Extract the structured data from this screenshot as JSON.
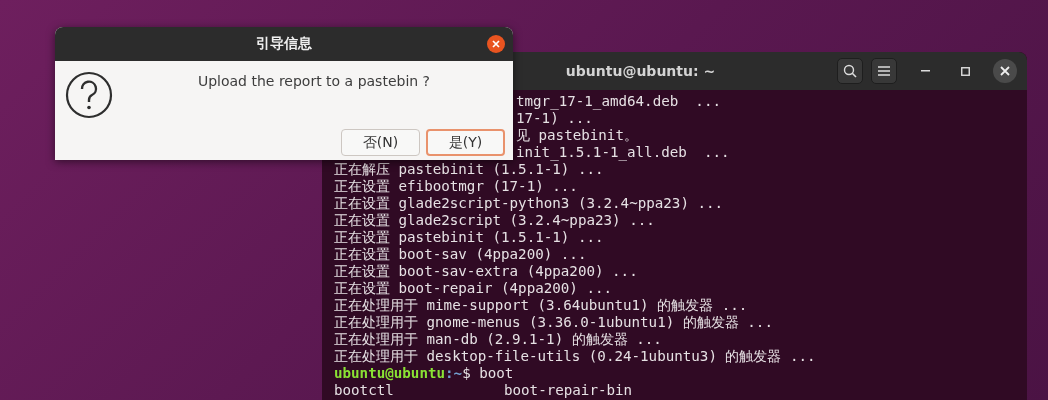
{
  "dialog": {
    "title": "引导信息",
    "message": "Upload the report to a pastebin ?",
    "buttons": [
      {
        "label": "否(N)",
        "selected": false
      },
      {
        "label": "是(Y)",
        "selected": true
      }
    ]
  },
  "terminal": {
    "title": "ubuntu@ubuntu: ~",
    "lines": [
      {
        "kind": "partial",
        "text": "tmgr_17-1_amd64.deb  ..."
      },
      {
        "kind": "partial",
        "text": "17-1) ..."
      },
      {
        "kind": "partial",
        "text": "见 pastebinit。"
      },
      {
        "kind": "partial",
        "text": "init_1.5.1-1_all.deb  ..."
      },
      {
        "kind": "output",
        "text": "正在解压 pastebinit (1.5.1-1) ..."
      },
      {
        "kind": "output",
        "text": "正在设置 efibootmgr (17-1) ..."
      },
      {
        "kind": "output",
        "text": "正在设置 glade2script-python3 (3.2.4~ppa23) ..."
      },
      {
        "kind": "output",
        "text": "正在设置 glade2script (3.2.4~ppa23) ..."
      },
      {
        "kind": "output",
        "text": "正在设置 pastebinit (1.5.1-1) ..."
      },
      {
        "kind": "output",
        "text": "正在设置 boot-sav (4ppa200) ..."
      },
      {
        "kind": "output",
        "text": "正在设置 boot-sav-extra (4ppa200) ..."
      },
      {
        "kind": "output",
        "text": "正在设置 boot-repair (4ppa200) ..."
      },
      {
        "kind": "output",
        "text": "正在处理用于 mime-support (3.64ubuntu1) 的触发器 ..."
      },
      {
        "kind": "output",
        "text": "正在处理用于 gnome-menus (3.36.0-1ubuntu1) 的触发器 ..."
      },
      {
        "kind": "output",
        "text": "正在处理用于 man-db (2.9.1-1) 的触发器 ..."
      },
      {
        "kind": "output",
        "text": "正在处理用于 desktop-file-utils (0.24-1ubuntu3) 的触发器 ..."
      },
      {
        "kind": "prompt",
        "user": "ubuntu@ubuntu",
        "path": ":~",
        "command": "$ boot"
      },
      {
        "kind": "columns",
        "cells": [
          "bootctl",
          "boot-repair-bin"
        ]
      }
    ]
  }
}
